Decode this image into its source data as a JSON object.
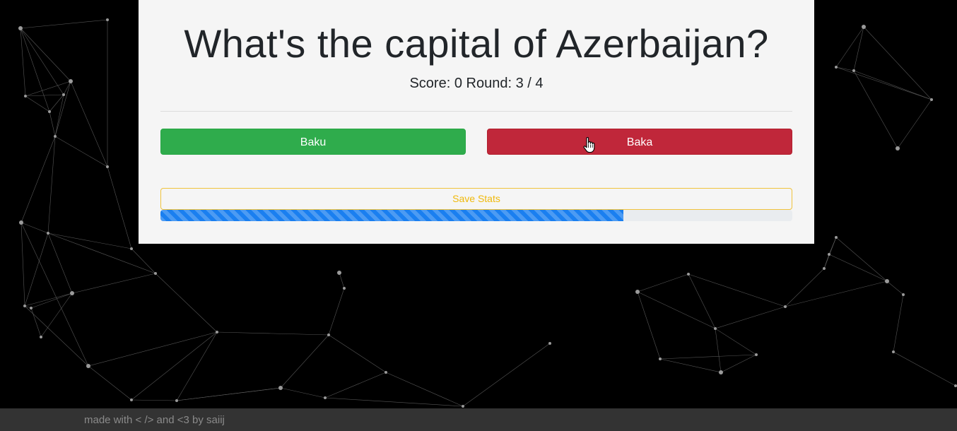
{
  "quiz": {
    "question": "What's the capital of Azerbaijan?",
    "score_label": "Score:",
    "score": "0",
    "round_label": "Round:",
    "round_current": "3",
    "round_separator": "/",
    "round_total": "4"
  },
  "answers": [
    {
      "label": "Baku",
      "color": "#2fac4c",
      "state": "correct"
    },
    {
      "label": "Baka",
      "color": "#c0273a",
      "state": "wrong"
    }
  ],
  "save_stats": {
    "label": "Save Stats",
    "color": "#f0b90b"
  },
  "progress": {
    "fraction": 0.733,
    "color": "#1a7ff0",
    "striped": true
  },
  "footer": {
    "text": "made with < /> and <3 by saiij"
  },
  "colors": {
    "background": "#000000",
    "card": "#f5f5f5",
    "footer": "#333333"
  },
  "icons": {
    "cursor": "hand-pointer-icon"
  }
}
